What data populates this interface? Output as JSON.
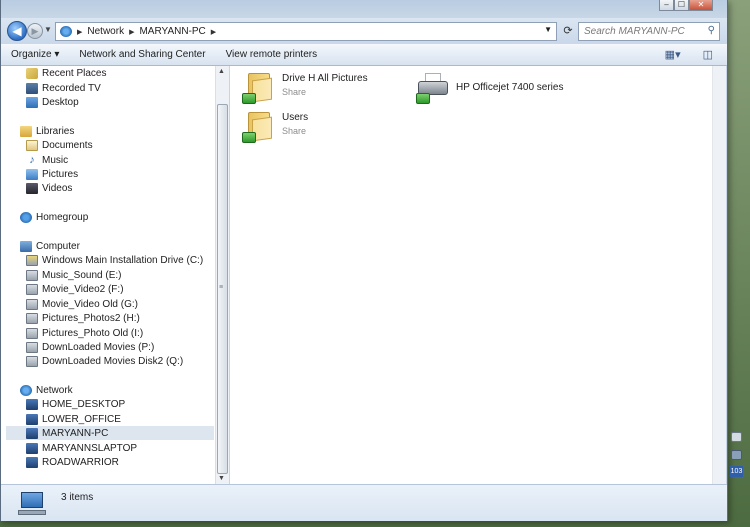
{
  "window": {
    "controls": {
      "minimize": "‒",
      "maximize": "☐",
      "close": "✕"
    }
  },
  "address_bar": {
    "crumbs": [
      "Network",
      "MARYANN-PC"
    ],
    "search_placeholder": "Search MARYANN-PC"
  },
  "toolbar": {
    "organize_label": "Organize ▾",
    "network_sharing_label": "Network and Sharing Center",
    "remote_printers_label": "View remote printers"
  },
  "nav": {
    "favorites": [
      "Recent Places",
      "Recorded TV",
      "Desktop"
    ],
    "libraries_label": "Libraries",
    "libraries": [
      "Documents",
      "Music",
      "Pictures",
      "Videos"
    ],
    "homegroup_label": "Homegroup",
    "computer_label": "Computer",
    "drives": [
      "Windows Main Installation Drive (C:)",
      "Music_Sound (E:)",
      "Movie_Video2 (F:)",
      "Movie_Video Old (G:)",
      "Pictures_Photos2 (H:)",
      "Pictures_Photo Old (I:)",
      "DownLoaded Movies (P:)",
      "DownLoaded Movies Disk2 (Q:)"
    ],
    "network_label": "Network",
    "network_items": [
      "HOME_DESKTOP",
      "LOWER_OFFICE",
      "MARYANN-PC",
      "MARYANNSLAPTOP",
      "ROADWARRIOR"
    ],
    "selected_network_item": "MARYANN-PC"
  },
  "content": {
    "items": [
      {
        "name": "Drive H All Pictures",
        "type": "Share",
        "icon": "shared-folder-icon"
      },
      {
        "name": "HP Officejet 7400 series",
        "type": "",
        "icon": "printer-icon"
      },
      {
        "name": "Users",
        "type": "Share",
        "icon": "shared-folder-icon"
      }
    ]
  },
  "details": {
    "count_text": "3 items"
  },
  "tray": {
    "badge": "103"
  }
}
